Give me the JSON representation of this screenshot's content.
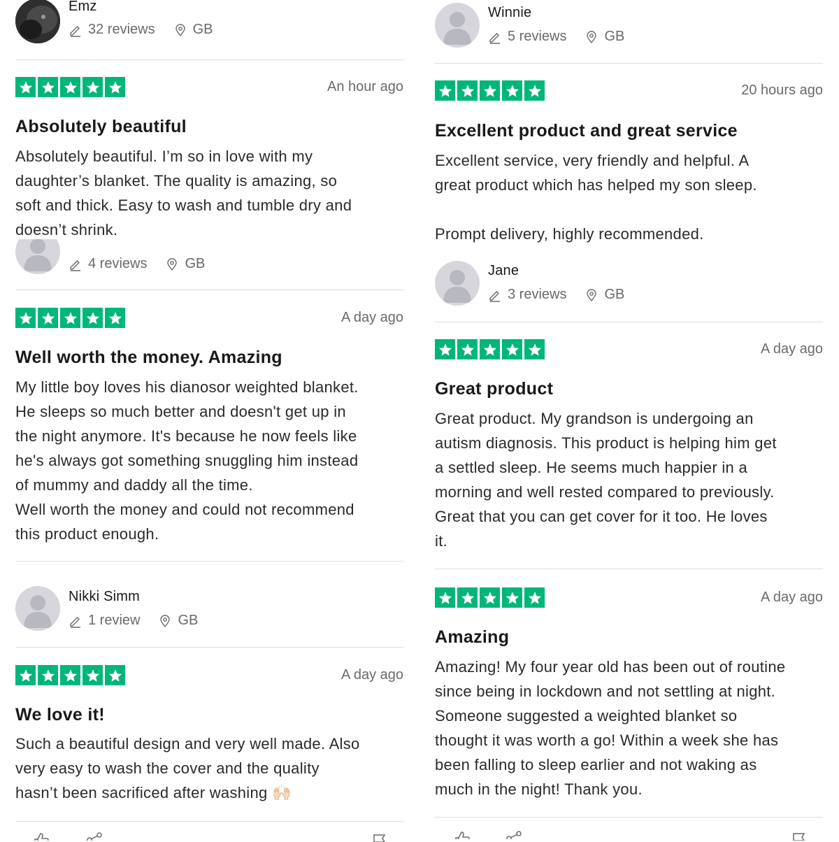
{
  "left_column": {
    "user1": {
      "name": "Emz",
      "reviews": "32 reviews",
      "country": "GB",
      "avatar": "profile-photo"
    },
    "review1": {
      "rating": 5,
      "date": "An hour ago",
      "title": "Absolutely beautiful",
      "body": "Absolutely beautiful. I’m so in love with my\ndaughter’s blanket. The quality is amazing, so\nsoft and thick. Easy to wash and tumble dry and\ndoesn’t shrink."
    },
    "user2": {
      "reviews": "4 reviews",
      "country": "GB",
      "avatar": "default-avatar"
    },
    "review2": {
      "rating": 5,
      "date": "A day ago",
      "title": "Well worth the money. Amazing",
      "body": "My little boy loves his dianosor weighted blanket.\nHe sleeps so much better and doesn't get up in\nthe night anymore. It's because he now feels like\nhe's always got something snuggling him instead\nof mummy and daddy all the time.\nWell worth the money and could not recommend\nthis product enough."
    },
    "user3": {
      "name": "Nikki Simm",
      "reviews": "1 review",
      "country": "GB",
      "avatar": "default-avatar"
    },
    "review3": {
      "rating": 5,
      "date": "A day ago",
      "title": "We love it!",
      "body": "Such a beautiful design and very well made. Also\nvery easy to wash the cover and the quality\nhasn’t been sacrificed after washing 🙌🏻"
    }
  },
  "right_column": {
    "user1": {
      "name": "Winnie",
      "reviews": "5 reviews",
      "country": "GB",
      "avatar": "default-avatar"
    },
    "review1": {
      "rating": 5,
      "date": "20 hours ago",
      "title": "Excellent product and great service",
      "body": "Excellent service, very friendly and helpful. A\ngreat product which has helped my son sleep.\n\nPrompt delivery, highly recommended."
    },
    "user2": {
      "name": "Jane",
      "reviews": "3 reviews",
      "country": "GB",
      "avatar": "default-avatar"
    },
    "review2": {
      "rating": 5,
      "date": "A day ago",
      "title": "Great product",
      "body": "Great product. My grandson is undergoing an\nautism diagnosis. This product is helping him get\na settled sleep. He seems much happier in a\nmorning and well rested compared to previously.\nGreat that you can get cover for it too. He loves\nit."
    },
    "review3": {
      "rating": 5,
      "date": "A day ago",
      "title": "Amazing",
      "body": "Amazing! My four year old has been out of routine\nsince being in lockdown and not settling at night.\nSomeone suggested a weighted blanket so\nthought it was worth a go! Within a week she has\nbeen falling to sleep earlier and not waking as\nmuch in the night! Thank you."
    }
  },
  "icons": {
    "review_count": "pencil-icon",
    "location": "location-pin-icon",
    "like": "thumbs-up-icon",
    "share": "share-icon",
    "report": "flag-icon"
  },
  "colors": {
    "star_green": "#00b67a",
    "text": "#191919",
    "muted": "#6a6a6a",
    "divider": "#dedede",
    "avatar_bg": "#d6d6dc"
  }
}
